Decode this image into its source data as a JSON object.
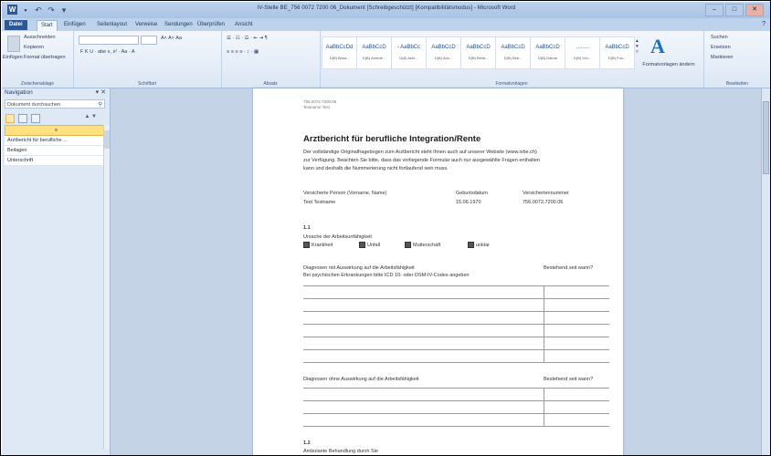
{
  "window": {
    "title": "IV-Stelle BE_756 0072 7200 06_Dokument [Schreibgeschützt] [Kompatibilitätsmodus] - Microsoft Word",
    "buttons": [
      "–",
      "□",
      "✕"
    ]
  },
  "qat": {
    "logo": "W",
    "undo": "↶",
    "redo": "↷",
    "more": "▾"
  },
  "tabs": [
    "Datei",
    "Start",
    "Einfügen",
    "Seitenlayout",
    "Verweise",
    "Sendungen",
    "Überprüfen",
    "Ansicht"
  ],
  "help_icon": "question-icon",
  "ribbon": {
    "clipboard": {
      "paste": "Einfügen",
      "cut": "Ausschneiden",
      "copy": "Kopieren",
      "format_painter": "Format übertragen",
      "caption": "Zwischenablage"
    },
    "font": {
      "caption": "Schriftart",
      "row2": "F K U · abe x, x² · Aa · A"
    },
    "paragraph": {
      "caption": "Absatz"
    },
    "styles": {
      "caption": "Formatvorlagen",
      "items": [
        {
          "preview": "AaBbCcDd",
          "name": "D(B) Absa..."
        },
        {
          "preview": "AaBbCcD",
          "name": "D(B) Anrede..."
        },
        {
          "preview": "- AaBbCc",
          "name": "D(B) Aufz..."
        },
        {
          "preview": "AaBbCcD",
          "name": "D(B) Aus..."
        },
        {
          "preview": "AaBbCcD",
          "name": "D(B) Beila..."
        },
        {
          "preview": "AaBbCcD",
          "name": "D(B) Betr..."
        },
        {
          "preview": "AaBbCcD",
          "name": "D(B) Datum"
        },
        {
          "preview": "........",
          "name": "D(B) Dot..."
        },
        {
          "preview": "AaBbCcD",
          "name": "D(B) Fus..."
        }
      ],
      "change": "Formatvorlagen ändern"
    },
    "editing": {
      "caption": "Bearbeiten",
      "find": "Suchen",
      "replace": "Ersetzen",
      "select": "Markieren"
    }
  },
  "nav": {
    "title": "Navigation",
    "close": "▾ ✕",
    "search_placeholder": "Dokument durchsuchen",
    "search_icon": "magnifier-icon",
    "arrows": "▲ ▼",
    "items": [
      "≡",
      "Arztbericht für berufliche ...",
      "Beilagen",
      "Unterschrift"
    ]
  },
  "document": {
    "header_line1": "756.0072.7200.06",
    "header_line2": "Testname Test",
    "title": "Arztbericht für berufliche Integration/Rente",
    "intro1": "Der vollständige Originalfragebogen zum Arztbericht steht Ihnen auch auf unserer Website (www.ivbe.ch)",
    "intro2": "zur Verfügung. Beachten Sie bitte, dass das vorliegende Formular auch nur ausgewählte Fragen enthalten",
    "intro3": "kann und deshalb die Nummerierung nicht fortlaufend sein muss.",
    "col_person": "Versicherte Person (Vorname, Name)",
    "col_birth": "Geburtsdatum",
    "col_number": "Versichertennummer",
    "person": "Test Testname",
    "birth": "15.06.1970",
    "number": "756.0072.7200.06",
    "sec11": "1.1",
    "cause_label": "Ursache der Arbeitsunfähigkeit",
    "cause_options": [
      "Krankheit",
      "Unfall",
      "Mutterschaft",
      "unklar"
    ],
    "diag_with": "Diagnosen mit Auswirkung auf die Arbeitsfähigkeit",
    "diag_with_hint": "Bei psychischen Erkrankungen bitte ICD 10- oder DSM-IV-Codes angeben",
    "since": "Bestehend seit wann?",
    "diag_without": "Diagnosen ohne Auswirkung auf die Arbeitsfähigkeit",
    "since2": "Bestehend seit wann?",
    "sec12": "1.2",
    "sec12_text": "Ambulante Behandlung durch Sie"
  }
}
